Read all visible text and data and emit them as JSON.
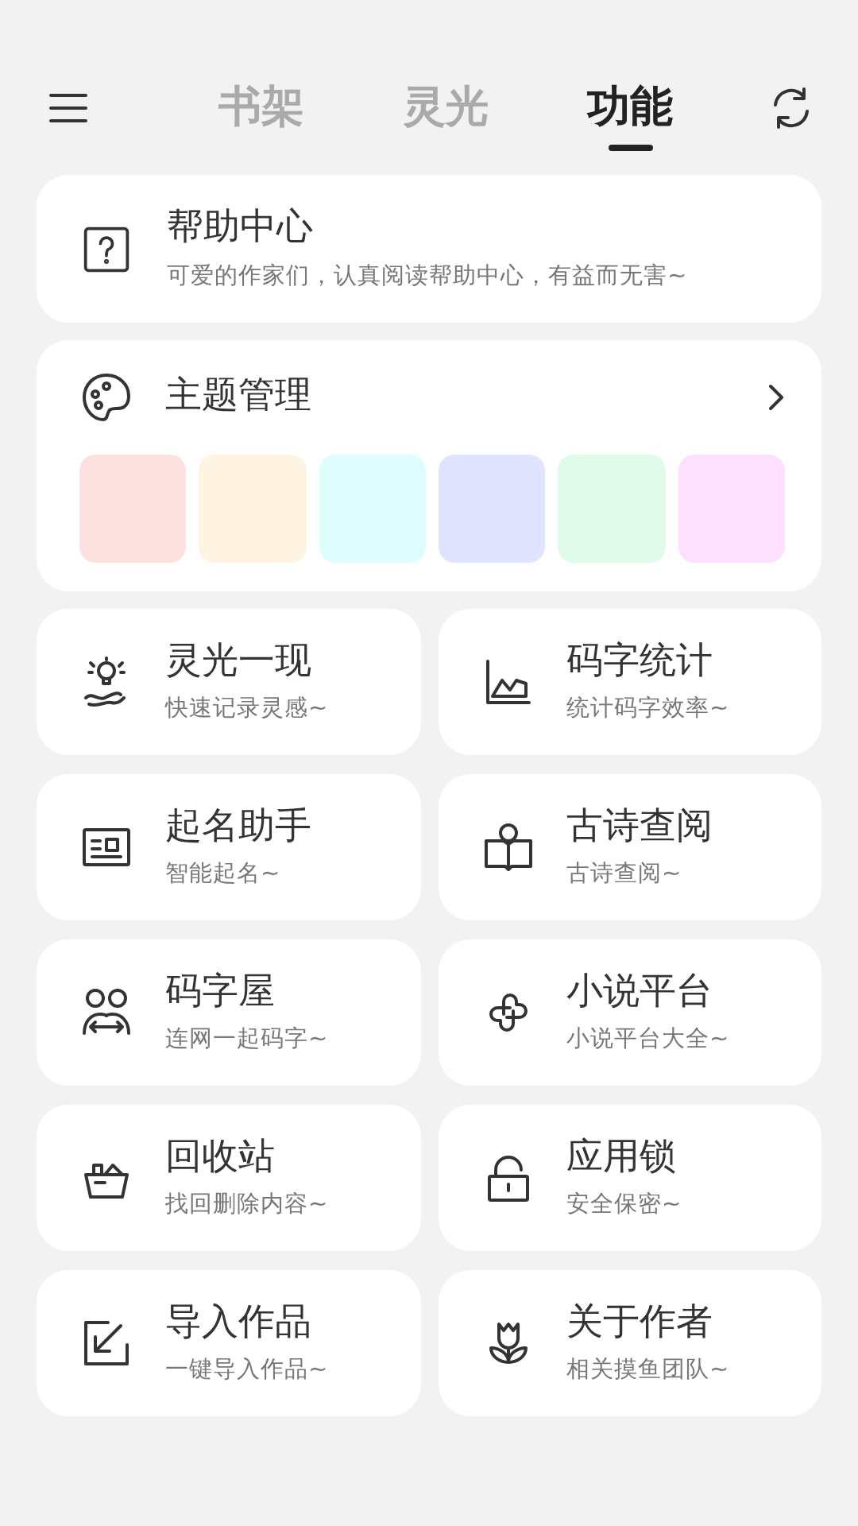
{
  "header": {
    "tabs": [
      {
        "label": "书架",
        "selected": false
      },
      {
        "label": "灵光",
        "selected": false
      },
      {
        "label": "功能",
        "selected": true
      }
    ]
  },
  "help_card": {
    "title": "帮助中心",
    "subtitle": "可爱的作家们，认真阅读帮助中心，有益而无害~"
  },
  "theme_card": {
    "title": "主题管理",
    "swatches": [
      {
        "color": "#fde1e1"
      },
      {
        "color": "#fff3e1"
      },
      {
        "color": "#ddfefd"
      },
      {
        "color": "#e0e4fd"
      },
      {
        "color": "#e0fbe9"
      },
      {
        "color": "#fde0fd"
      }
    ]
  },
  "features": [
    {
      "title": "灵光一现",
      "subtitle": "快速记录灵感~"
    },
    {
      "title": "码字统计",
      "subtitle": "统计码字效率~"
    },
    {
      "title": "起名助手",
      "subtitle": "智能起名~"
    },
    {
      "title": "古诗查阅",
      "subtitle": "古诗查阅~"
    },
    {
      "title": "码字屋",
      "subtitle": "连网一起码字~"
    },
    {
      "title": "小说平台",
      "subtitle": "小说平台大全~"
    },
    {
      "title": "回收站",
      "subtitle": "找回删除内容~"
    },
    {
      "title": "应用锁",
      "subtitle": "安全保密~"
    },
    {
      "title": "导入作品",
      "subtitle": "一键导入作品~"
    },
    {
      "title": "关于作者",
      "subtitle": "相关摸鱼团队~"
    }
  ]
}
